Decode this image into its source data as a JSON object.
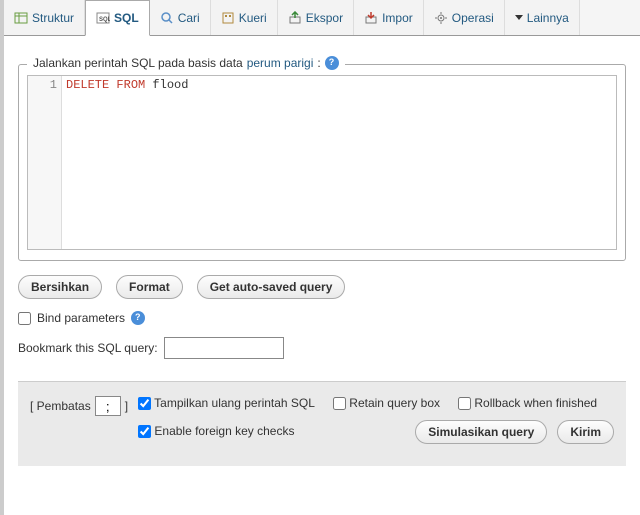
{
  "tabs": {
    "struktur": "Struktur",
    "sql": "SQL",
    "cari": "Cari",
    "kueri": "Kueri",
    "ekspor": "Ekspor",
    "impor": "Impor",
    "operasi": "Operasi",
    "lainnya": "Lainnya"
  },
  "legend": {
    "prefix": "Jalankan perintah SQL pada basis data ",
    "dbname": "perum parigi",
    "suffix": ":"
  },
  "editor": {
    "line_number": "1",
    "kw1": "DELETE",
    "kw2": "FROM",
    "rest": " flood"
  },
  "buttons": {
    "bersihkan": "Bersihkan",
    "format": "Format",
    "get_autosaved": "Get auto-saved query",
    "simulasikan": "Simulasikan query",
    "kirim": "Kirim"
  },
  "labels": {
    "bind_params": "Bind parameters",
    "bookmark": "Bookmark this SQL query:",
    "pembatas_l": "[ Pembatas",
    "pembatas_r": "]",
    "tampilkan_ulang": "Tampilkan ulang perintah SQL",
    "retain": "Retain query box",
    "rollback": "Rollback when finished",
    "enable_fk": "Enable foreign key checks"
  },
  "values": {
    "delimiter": ";",
    "bookmark_value": ""
  },
  "checked": {
    "bind_params": false,
    "tampilkan_ulang": true,
    "retain": false,
    "rollback": false,
    "enable_fk": true
  }
}
